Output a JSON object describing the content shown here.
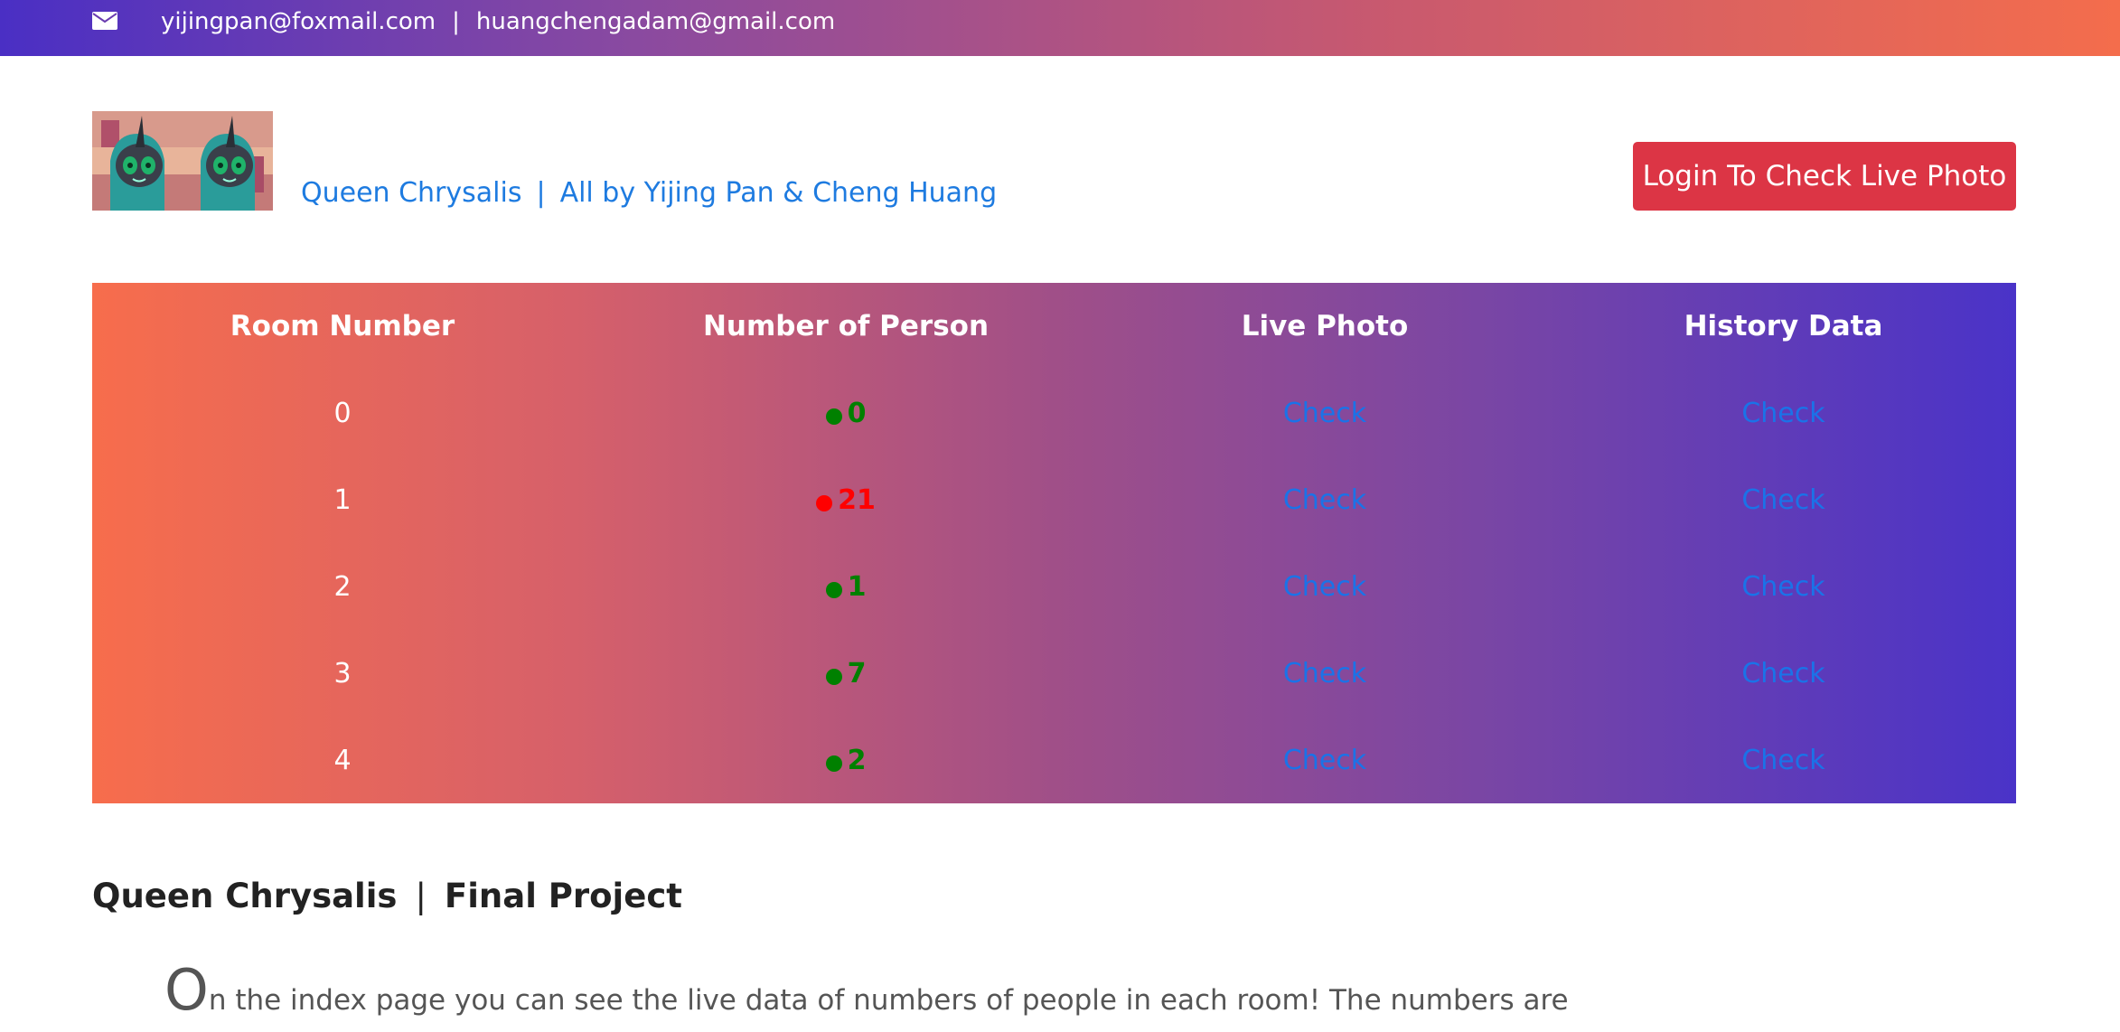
{
  "topbar": {
    "icon": "envelope-icon",
    "email1": "yijingpan@foxmail.com",
    "separator": "|",
    "email2": "huangchengadam@gmail.com"
  },
  "header": {
    "brand": "Queen Chrysalis",
    "separator": "|",
    "authors": "All by Yijing Pan & Cheng Huang",
    "login_label": "Login To Check Live Photo"
  },
  "table": {
    "headers": [
      "Room Number",
      "Number of Person",
      "Live Photo",
      "History Data"
    ],
    "rows": [
      {
        "room": "0",
        "count": "0",
        "status_color": "#008000",
        "live": "Check",
        "history": "Check"
      },
      {
        "room": "1",
        "count": "21",
        "status_color": "#ff0000",
        "live": "Check",
        "history": "Check"
      },
      {
        "room": "2",
        "count": "1",
        "status_color": "#008000",
        "live": "Check",
        "history": "Check"
      },
      {
        "room": "3",
        "count": "7",
        "status_color": "#008000",
        "live": "Check",
        "history": "Check"
      },
      {
        "room": "4",
        "count": "2",
        "status_color": "#008000",
        "live": "Check",
        "history": "Check"
      }
    ]
  },
  "section": {
    "title_left": "Queen Chrysalis",
    "separator": "|",
    "title_right": "Final Project",
    "dropcap": "O",
    "paragraph_rest": "n the index page you can see the live data of numbers of people in each room! The numbers are"
  },
  "colors": {
    "button_red": "#dc3545",
    "link_blue": "#1a73e8",
    "ok_green": "#008000",
    "alert_red": "#ff0000"
  }
}
